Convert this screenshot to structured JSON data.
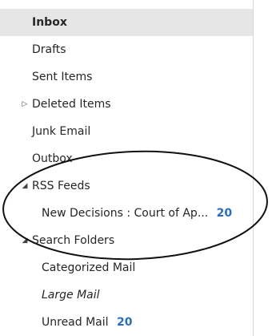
{
  "folders": {
    "inbox": {
      "label": "Inbox"
    },
    "drafts": {
      "label": "Drafts"
    },
    "sent": {
      "label": "Sent Items"
    },
    "deleted": {
      "label": "Deleted Items",
      "toggle": "▷"
    },
    "junk": {
      "label": "Junk Email"
    },
    "outbox": {
      "label": "Outbox"
    },
    "rss": {
      "label": "RSS Feeds",
      "toggle": "◢"
    },
    "new_decisions": {
      "label": "New Decisions : Court of Ap...",
      "count": "20"
    },
    "search": {
      "label": "Search Folders",
      "toggle": "◢"
    },
    "categorized": {
      "label": "Categorized Mail"
    },
    "large": {
      "label": "Large Mail"
    },
    "unread": {
      "label": "Unread Mail",
      "count": "20"
    }
  },
  "colors": {
    "count": "#2a6ebb",
    "selected_bg": "#e6e6e6",
    "divider": "#d6d6d6"
  }
}
